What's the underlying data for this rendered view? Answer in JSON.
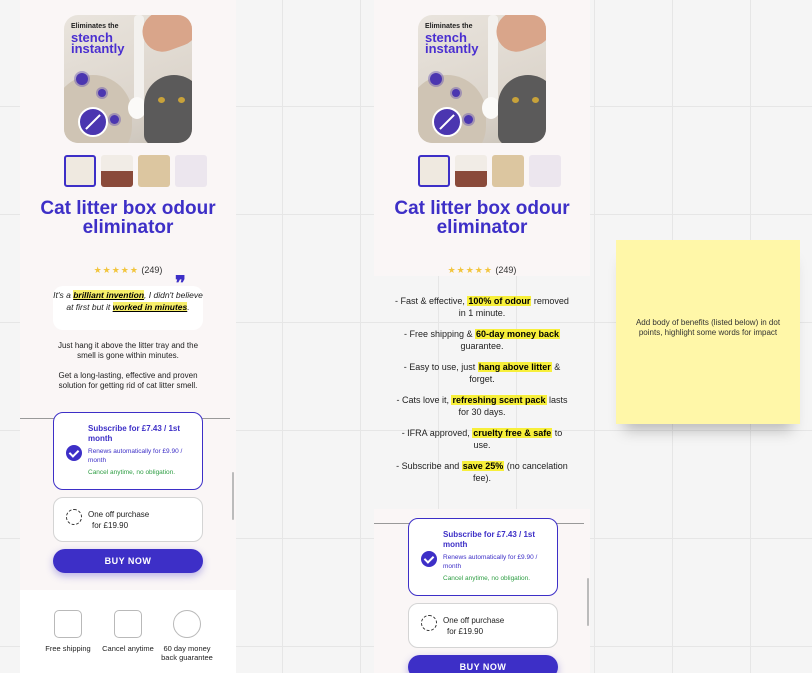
{
  "product": {
    "hero_tag": "Eliminates the",
    "hero_headline": "stench instantly",
    "title": "Cat litter box odour eliminator",
    "rating_stars": "★★★★★",
    "review_count": "(249)"
  },
  "testimonial": {
    "pre": "It's a ",
    "highlight1": "brilliant invention",
    "mid": ", I didn't believe at first but it ",
    "highlight2": "worked in minutes",
    "post": ".",
    "quote_glyph": "❞"
  },
  "description": {
    "line1": "Just hang it above the litter tray and the smell is gone within minutes.",
    "line2": "Get a long-lasting, effective and proven solution for getting rid of cat litter smell."
  },
  "subscription": {
    "heading": "Subscribe for £7.43 / 1st month",
    "renew": "Renews automatically for £9.90 / month",
    "cancel": "Cancel anytime, no obligation."
  },
  "one_off": {
    "heading": "One off purchase",
    "price": "for £19.90"
  },
  "buy_label": "BUY NOW",
  "features": [
    {
      "icon": "truck-icon",
      "label": "Free shipping"
    },
    {
      "icon": "cancel-icon",
      "label": "Cancel anytime"
    },
    {
      "icon": "money-back-icon",
      "label": "60 day money back guarantee"
    }
  ],
  "benefits": [
    {
      "pre": "- Fast & effective, ",
      "hl": "100% of odour",
      "post": " removed in 1 minute."
    },
    {
      "pre": "- Free shipping & ",
      "hl": "60-day money back",
      "post": " guarantee."
    },
    {
      "pre": "- Easy to use, just ",
      "hl": "hang above litter",
      "post": " & forget."
    },
    {
      "pre": "- Cats love it, ",
      "hl": "refreshing scent pack",
      "post": " lasts for 30 days."
    },
    {
      "pre": "- IFRA approved, ",
      "hl": "cruelty free & safe",
      "post": " to use."
    },
    {
      "pre": "- Subscribe and ",
      "hl": "save 25%",
      "post": " (no cancelation fee)."
    }
  ],
  "sticky_note": "Add body of benefits (listed below) in dot points, highlight some words for impact",
  "colors": {
    "brand": "#3d2fc7",
    "highlight": "#f7ef3a",
    "sticky": "#fff7a8",
    "green": "#2f9e44"
  }
}
